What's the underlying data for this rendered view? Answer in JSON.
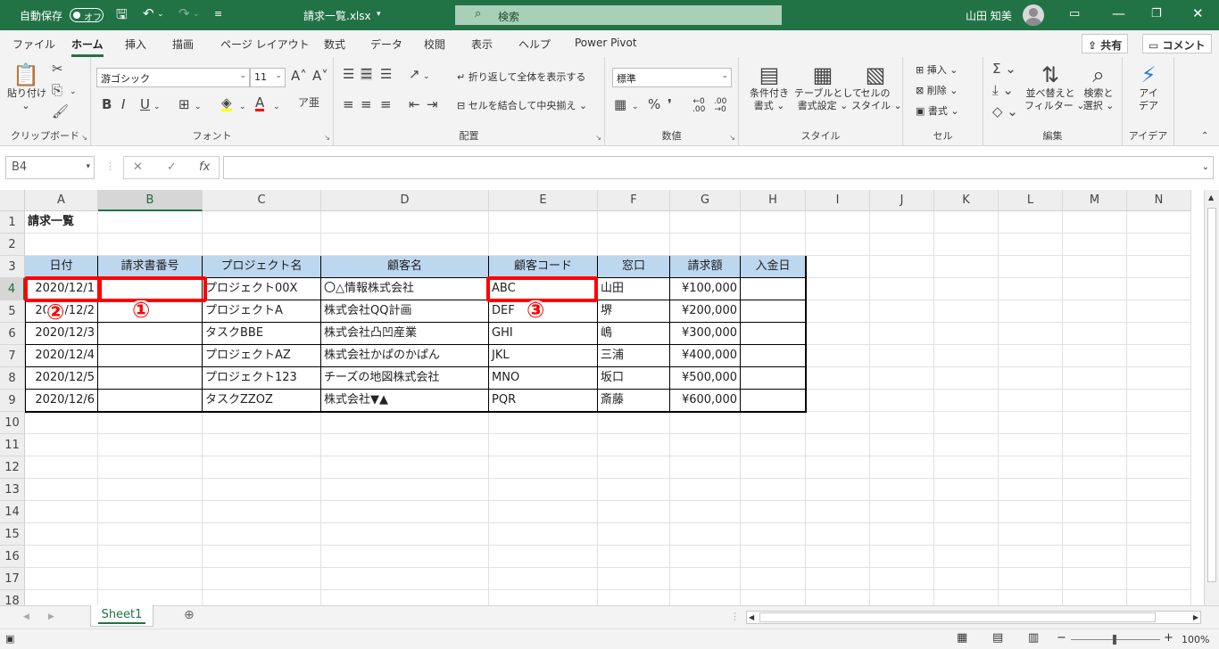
{
  "titlebar": {
    "autosave_label": "自動保存",
    "autosave_state": "オフ",
    "filename": "請求一覧.xlsx",
    "search_placeholder": "検索",
    "user_name": "山田 知美"
  },
  "ribbon_tabs": [
    "ファイル",
    "ホーム",
    "挿入",
    "描画",
    "ページ レイアウト",
    "数式",
    "データ",
    "校閲",
    "表示",
    "ヘルプ",
    "Power Pivot"
  ],
  "share_label": "共有",
  "comment_label": "コメント",
  "ribbon": {
    "clipboard": {
      "paste": "貼り付け",
      "label": "クリップボード"
    },
    "font": {
      "name": "游ゴシック",
      "size": "11",
      "label": "フォント"
    },
    "alignment": {
      "wrap": "折り返して全体を表示する",
      "merge": "セルを結合して中央揃え",
      "label": "配置"
    },
    "number": {
      "format": "標準",
      "label": "数値"
    },
    "styles": {
      "cond1": "条件付き",
      "cond2": "書式",
      "table1": "テーブルとして",
      "table2": "書式設定",
      "cell1": "セルの",
      "cell2": "スタイル",
      "label": "スタイル"
    },
    "cells": {
      "insert": "挿入",
      "delete": "削除",
      "format": "書式",
      "label": "セル"
    },
    "editing": {
      "sort1": "並べ替えと",
      "sort2": "フィルター",
      "find1": "検索と",
      "find2": "選択",
      "label": "編集"
    },
    "ideas": {
      "t1": "アイ",
      "t2": "デア",
      "label": "アイデア"
    }
  },
  "formula_bar": {
    "name_box": "B4",
    "formula": ""
  },
  "columns": [
    "A",
    "B",
    "C",
    "D",
    "E",
    "F",
    "G",
    "H",
    "I",
    "J",
    "K",
    "L",
    "M",
    "N"
  ],
  "rows": [
    "1",
    "2",
    "3",
    "4",
    "5",
    "6",
    "7",
    "8",
    "9",
    "10",
    "11",
    "12",
    "13",
    "14",
    "15",
    "16",
    "17",
    "18"
  ],
  "sheet": {
    "title": "請求一覧",
    "headers": [
      "日付",
      "請求書番号",
      "プロジェクト名",
      "顧客名",
      "顧客コード",
      "窓口",
      "請求額",
      "入金日"
    ],
    "data": [
      [
        "2020/12/1",
        "",
        "プロジェクト00X",
        "〇△情報株式会社",
        "ABC",
        "山田",
        "¥100,000",
        ""
      ],
      [
        "2020/12/2",
        "",
        "プロジェクトA",
        "株式会社QQ計画",
        "DEF",
        "堺",
        "¥200,000",
        ""
      ],
      [
        "2020/12/3",
        "",
        "タスクBBE",
        "株式会社凸凹産業",
        "GHI",
        "嶋",
        "¥300,000",
        ""
      ],
      [
        "2020/12/4",
        "",
        "プロジェクトAZ",
        "株式会社かぱのかぱん",
        "JKL",
        "三浦",
        "¥400,000",
        ""
      ],
      [
        "2020/12/5",
        "",
        "プロジェクト123",
        "チーズの地図株式会社",
        "MNO",
        "坂口",
        "¥500,000",
        ""
      ],
      [
        "2020/12/6",
        "",
        "タスクZZOZ",
        "株式会社▼▲",
        "PQR",
        "斎藤",
        "¥600,000",
        ""
      ]
    ]
  },
  "annotations": [
    "①",
    "②",
    "③"
  ],
  "sheet_tab": "Sheet1",
  "status": {
    "zoom": "100%"
  },
  "colors": {
    "accent": "#217346",
    "header_fill": "#bdd7ee",
    "annotation": "#ff0000"
  }
}
